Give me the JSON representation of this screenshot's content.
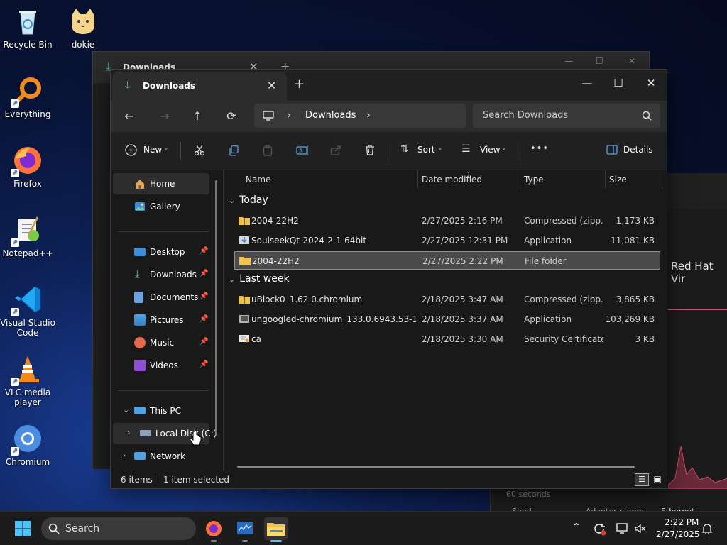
{
  "desktop": {
    "icons": [
      {
        "label": "Recycle Bin"
      },
      {
        "label": "dokie"
      },
      {
        "label": "Everything"
      },
      {
        "label": "Firefox"
      },
      {
        "label": "Notepad++"
      },
      {
        "label": "Visual Studio Code"
      },
      {
        "label": "VLC media player"
      },
      {
        "label": "Chromium"
      }
    ]
  },
  "background_window": {
    "title_partial": "Red Hat Vir",
    "axis_label": "60 seconds",
    "footer": [
      "Send",
      "Adapter name:",
      "Ethernet"
    ]
  },
  "ghost_window": {
    "tab_title": "Downloads"
  },
  "explorer": {
    "tab_title": "Downloads",
    "new_tab_glyph": "+",
    "window_controls": {
      "minimize": "—",
      "maximize": "☐",
      "close": "✕"
    },
    "nav": {
      "back": "←",
      "forward": "→",
      "up": "↑",
      "refresh": "⟳"
    },
    "address": {
      "segment": "Downloads",
      "separator": "›"
    },
    "search": {
      "placeholder": "Search Downloads"
    },
    "toolbar": {
      "new_label": "New",
      "sort_label": "Sort",
      "view_label": "View",
      "more_label": "•••",
      "details_label": "Details"
    },
    "sidebar": {
      "quick": [
        {
          "label": "Home",
          "selected": true
        },
        {
          "label": "Gallery",
          "selected": false
        }
      ],
      "pinned": [
        {
          "label": "Desktop"
        },
        {
          "label": "Downloads"
        },
        {
          "label": "Documents"
        },
        {
          "label": "Pictures"
        },
        {
          "label": "Music"
        },
        {
          "label": "Videos"
        }
      ],
      "this_pc": "This PC",
      "local_disk": "Local Disk (C:)",
      "network": "Network"
    },
    "columns": {
      "name": "Name",
      "date": "Date modified",
      "type": "Type",
      "size": "Size"
    },
    "groups": [
      {
        "label": "Today",
        "rows": [
          {
            "name": "2004-22H2",
            "date": "2/27/2025 2:16 PM",
            "type": "Compressed (zipp...",
            "size": "1,173 KB",
            "icon": "zip-folder"
          },
          {
            "name": "SoulseekQt-2024-2-1-64bit",
            "date": "2/27/2025 12:31 PM",
            "type": "Application",
            "size": "11,081 KB",
            "icon": "installer"
          },
          {
            "name": "2004-22H2",
            "date": "2/27/2025 2:22 PM",
            "type": "File folder",
            "size": "",
            "icon": "folder",
            "selected": true
          }
        ]
      },
      {
        "label": "Last week",
        "rows": [
          {
            "name": "uBlock0_1.62.0.chromium",
            "date": "2/18/2025 3:47 AM",
            "type": "Compressed (zipp...",
            "size": "3,865 KB",
            "icon": "zip-folder"
          },
          {
            "name": "ungoogled-chromium_133.0.6943.53-1.1...",
            "date": "2/18/2025 3:37 AM",
            "type": "Application",
            "size": "103,269 KB",
            "icon": "installer"
          },
          {
            "name": "ca",
            "date": "2/18/2025 3:30 AM",
            "type": "Security Certificate",
            "size": "3 KB",
            "icon": "certificate"
          }
        ]
      }
    ],
    "status": {
      "items": "6 items",
      "selected": "1 item selected"
    }
  },
  "taskbar": {
    "search_label": "Search",
    "time": "2:22 PM",
    "date": "2/27/2025"
  },
  "colors": {
    "accent": "#0078d4",
    "folder": "#f1c24b",
    "selection": "#4a4a4a"
  }
}
